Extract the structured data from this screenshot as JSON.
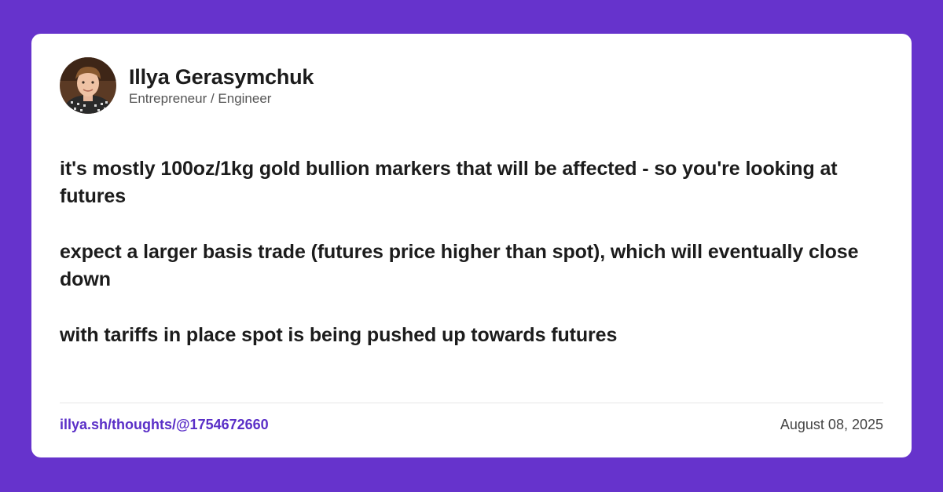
{
  "author": {
    "name": "Illya Gerasymchuk",
    "role": "Entrepreneur / Engineer"
  },
  "post": {
    "paragraphs": [
      "it's mostly 100oz/1kg gold bullion markers that will be affected - so you're looking at futures",
      "expect a larger basis trade (futures price higher than spot), which will eventually close down",
      "with tariffs in place spot is being pushed up towards futures"
    ]
  },
  "footer": {
    "link": "illya.sh/thoughts/@1754672660",
    "date": "August 08, 2025"
  },
  "colors": {
    "background": "#6633cc",
    "card": "#ffffff",
    "link": "#5a2fc7",
    "text": "#1c1c1c"
  }
}
